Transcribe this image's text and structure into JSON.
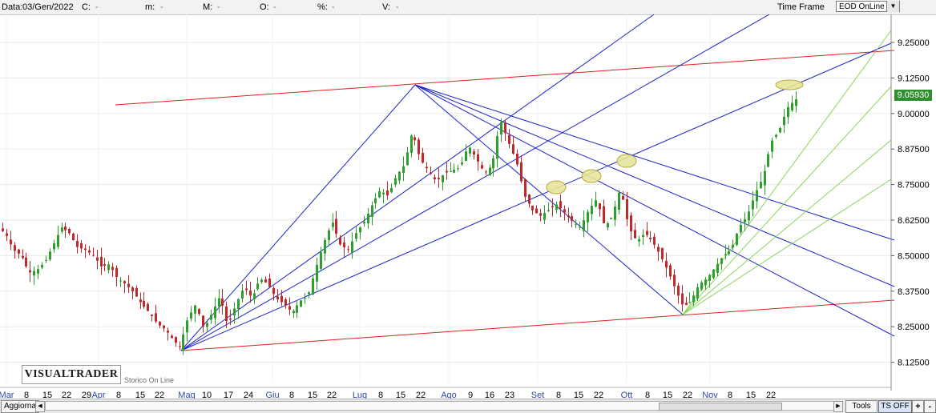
{
  "header": {
    "date_label": "Data:",
    "date_value": "03/Gen/2022",
    "fields": [
      {
        "label": "C:",
        "value": "-"
      },
      {
        "label": "m:",
        "value": "-"
      },
      {
        "label": "M:",
        "value": "-"
      },
      {
        "label": "O:",
        "value": "-"
      },
      {
        "label": "%:",
        "value": "-"
      },
      {
        "label": "V:",
        "value": "-"
      }
    ],
    "time_frame_label": "Time Frame",
    "time_frame_value": "EOD OnLine"
  },
  "branding": {
    "logo": "VISUALTRADER",
    "subtitle": "Storico On Line"
  },
  "chart_data": {
    "type": "candlestick",
    "y_ticks": [
      "9.25000",
      "9.12500",
      "9.00000",
      "8.87500",
      "8.75000",
      "8.62500",
      "8.50000",
      "8.37500",
      "8.25000",
      "8.12500"
    ],
    "ylim": [
      8.06,
      9.32
    ],
    "x_ticks": [
      "Mar",
      "8",
      "15",
      "22",
      "29",
      "Apr",
      "8",
      "15",
      "22",
      "Mag",
      "10",
      "17",
      "24",
      "Giu",
      "8",
      "15",
      "22",
      "Lug",
      "8",
      "15",
      "22",
      "Ago",
      "9",
      "16",
      "23",
      "Set",
      "8",
      "15",
      "22",
      "Ott",
      "8",
      "15",
      "22",
      "Nov",
      "8",
      "15",
      "22"
    ],
    "last_price": "9.05930",
    "up_color": "#2e9e2e",
    "down_color": "#c0282c",
    "trendline_color_support": "#e02020",
    "trendline_color_fan": "#1a24c8",
    "trendline_color_green_fan": "#8ad45a",
    "highlight_color": "#e6e49a"
  },
  "footer": {
    "refresh_label": "Aggiorna",
    "tools_label": "Tools",
    "ts_label": "TS OFF",
    "zoom_in": "+",
    "zoom_out": "-"
  }
}
